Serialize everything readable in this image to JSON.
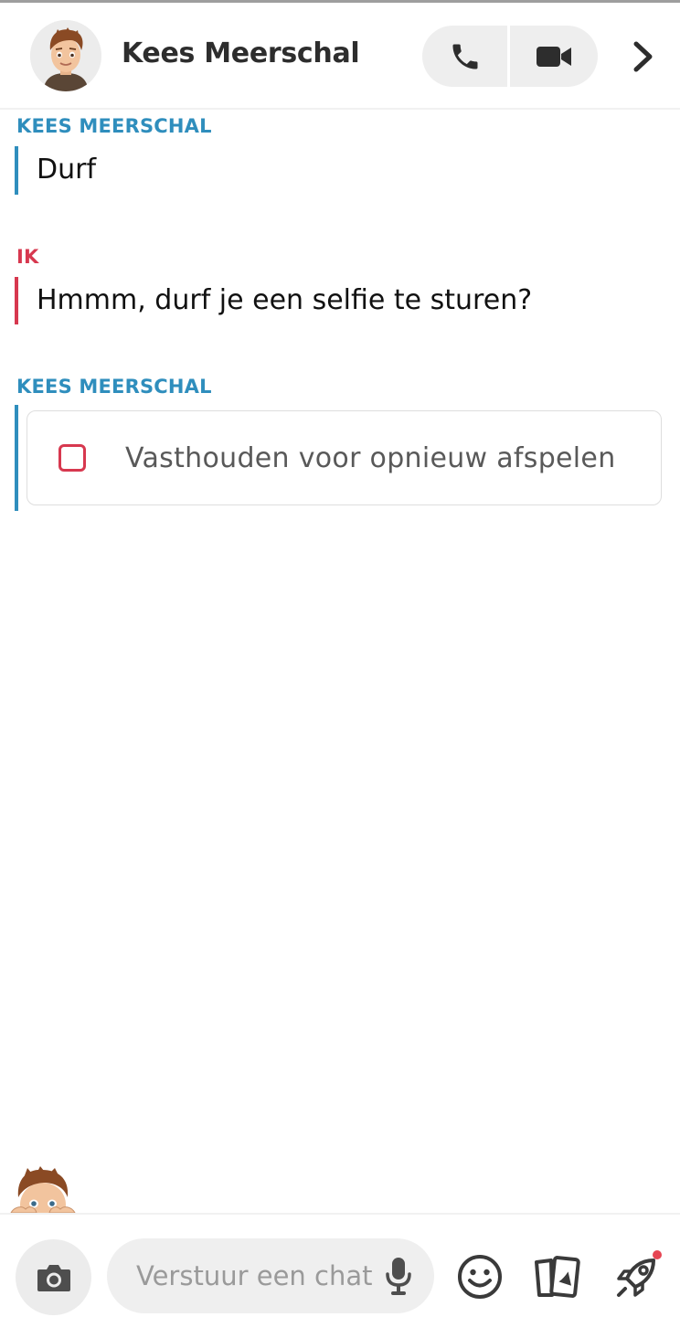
{
  "header": {
    "contact_name": "Kees Meerschal",
    "call_icon": "phone-icon",
    "video_icon": "video-camera-icon",
    "chevron_icon": "chevron-right-icon"
  },
  "messages": [
    {
      "sender": "KEES MEERSCHAL",
      "text": "Durf",
      "side": "them"
    },
    {
      "sender": "IK",
      "text": "Hmmm, durf je een selfie te sturen?",
      "side": "me"
    },
    {
      "sender": "KEES MEERSCHAL",
      "replay_label": "Vasthouden voor opnieuw afspelen",
      "side": "them",
      "kind": "snap-replay"
    }
  ],
  "composer": {
    "placeholder": "Verstuur een chat",
    "camera_icon": "camera-icon",
    "mic_icon": "microphone-icon",
    "emoji_icon": "smiley-icon",
    "stickers_icon": "cards-icon",
    "games_icon": "rocket-icon"
  },
  "colors": {
    "them": "#2f8ebd",
    "me": "#d7384f",
    "pill": "#eeeeee",
    "icon_dark": "#2d2d2d"
  }
}
